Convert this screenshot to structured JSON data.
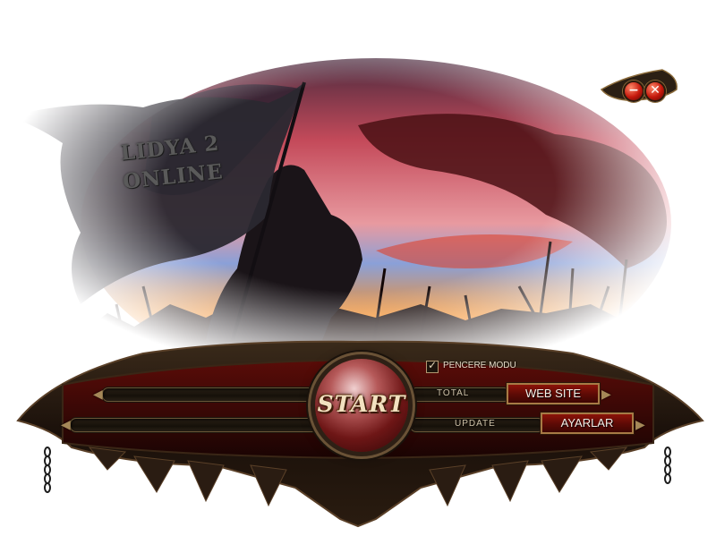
{
  "banner": {
    "line1": "LIDYA 2",
    "line2": "ONLINE"
  },
  "window_controls": {
    "minimize_glyph": "−",
    "close_glyph": "✕"
  },
  "options": {
    "window_mode_label": "PENCERE MODU",
    "window_mode_checked": true
  },
  "progress": {
    "total_label": "TOTAL",
    "update_label": "UPDATE"
  },
  "buttons": {
    "start": "START",
    "web_site": "WEB SITE",
    "settings": "AYARLAR"
  },
  "colors": {
    "accent_red": "#6d0e06",
    "gold_trim": "#a77a45",
    "sky_orange": "#f26b1d"
  }
}
